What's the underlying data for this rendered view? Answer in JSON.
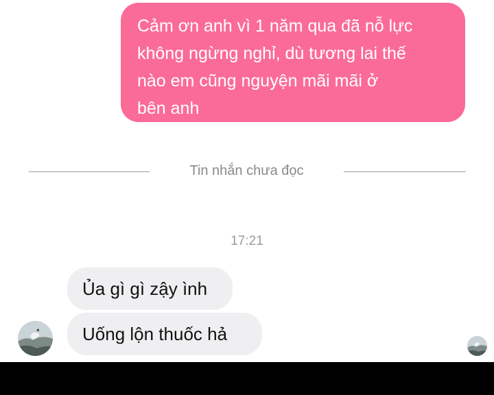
{
  "messages": {
    "outgoing": [
      {
        "text": "Cảm ơn anh vì 1 năm qua đã nỗ lực\nkhông ngừng nghỉ, dù tương lai thế\nnào em cũng nguyện mãi mãi ở\nbên anh"
      }
    ],
    "incoming": [
      {
        "text": "Ủa gì gì zậy ình"
      },
      {
        "text": "Uống lộn thuốc hả"
      }
    ]
  },
  "unread_divider": {
    "label": "Tin nhắn chưa đọc"
  },
  "timestamp": "17:21",
  "colors": {
    "outgoing_bubble": "#fb6b98",
    "incoming_bubble": "#efeff1",
    "background": "#ffffff"
  },
  "icons": {
    "sender_avatar": "sender-avatar-icon",
    "seen_avatar": "seen-avatar-icon"
  }
}
